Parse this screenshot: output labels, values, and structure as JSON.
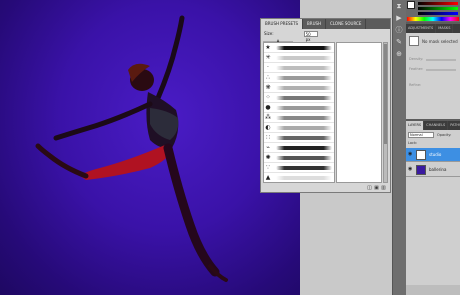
{
  "brush_panel": {
    "tabs": [
      "BRUSH PRESETS",
      "BRUSH",
      "CLONE SOURCE"
    ],
    "size_label": "Size:",
    "size_value": "50 px",
    "brushes": [
      {
        "icon": "★",
        "stroke": "#111"
      },
      {
        "icon": "✳",
        "stroke": "#c8c8c8"
      },
      {
        "icon": "·",
        "stroke": "#bdbdbd"
      },
      {
        "icon": "∴",
        "stroke": "#9a9a9a"
      },
      {
        "icon": "❋",
        "stroke": "#b0b0b0"
      },
      {
        "icon": "⁘",
        "stroke": "#777"
      },
      {
        "icon": "●",
        "stroke": "#999"
      },
      {
        "icon": "⁂",
        "stroke": "#888"
      },
      {
        "icon": "◐",
        "stroke": "#aaa"
      },
      {
        "icon": "∷",
        "stroke": "#666"
      },
      {
        "icon": "⌁",
        "stroke": "#222"
      },
      {
        "icon": "✺",
        "stroke": "#555"
      },
      {
        "icon": "∵",
        "stroke": "#333"
      },
      {
        "icon": "▲",
        "stroke": "#ddd"
      }
    ]
  },
  "adjustments": {
    "tabs": [
      "ADJUSTMENTS",
      "MASKS"
    ],
    "mask_text": "No mask selected",
    "rows": [
      "Density:",
      "Feather:",
      "Refine:"
    ]
  },
  "layers": {
    "tabs": [
      "LAYERS",
      "CHANNELS",
      "PATHS"
    ],
    "blend_mode": "Normal",
    "opacity_label": "Opacity:",
    "lock_label": "Lock:",
    "items": [
      {
        "name": "studio",
        "selected": true,
        "thumb": "#ffffff"
      },
      {
        "name": "ballerina",
        "selected": false,
        "thumb": "#3a1aa0"
      }
    ]
  },
  "colors": {
    "canvas_bg": "#3a12a8",
    "selected_layer": "#3d8fe3"
  }
}
